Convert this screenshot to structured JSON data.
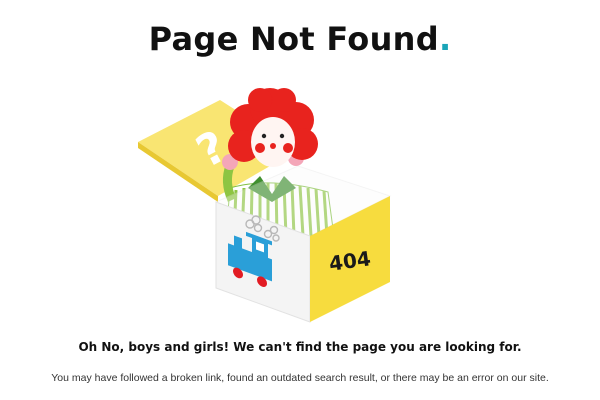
{
  "page": {
    "title": "Page Not Found",
    "title_dot": ".",
    "accent_color": "#1aa5b8",
    "headline": "Oh No, boys and girls! We can't find the page you are looking for.",
    "subtext": "You may have followed a broken link, found an outdated search result, or there may be an error on our site."
  },
  "illustration": {
    "box_label": "404",
    "lid_symbol": "?",
    "icons": [
      "jack-in-the-box-clown-icon",
      "toy-train-icon",
      "question-mark-icon"
    ],
    "colors": {
      "box_yellow": "#f7dc3e",
      "lid_yellow": "#f9e572",
      "clown_hair": "#e8231e",
      "train_blue": "#2a9fd8",
      "wheel_red": "#e21b23",
      "stripe_green": "#8ec542"
    }
  }
}
